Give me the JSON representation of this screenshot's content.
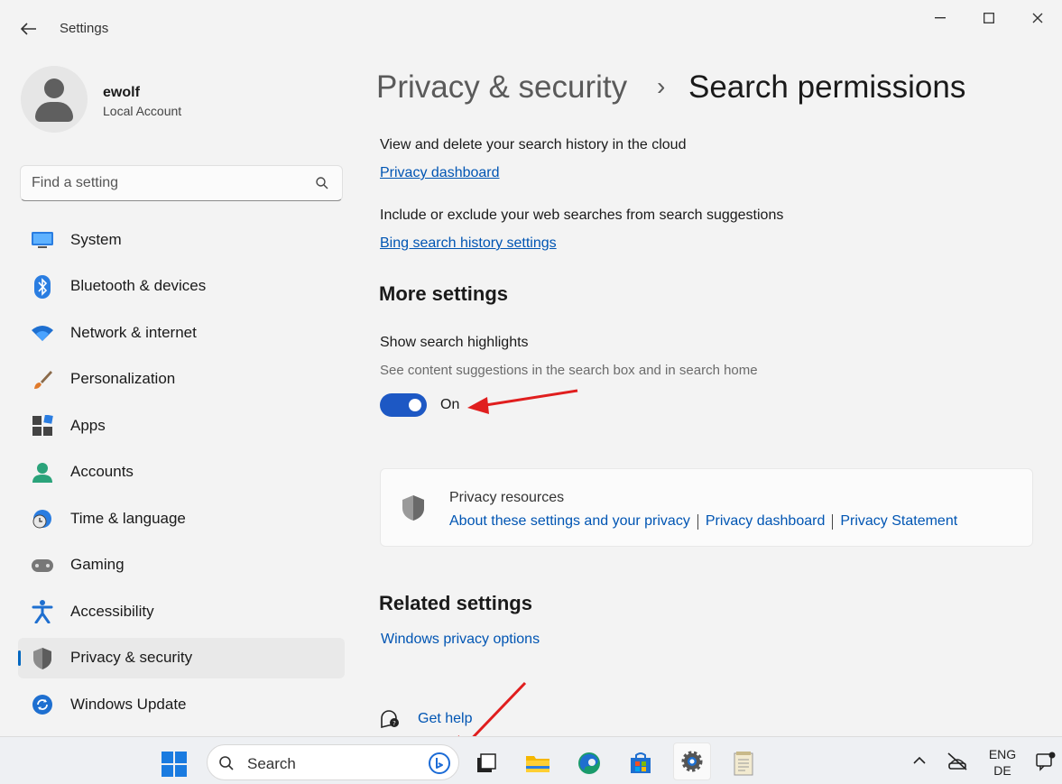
{
  "window": {
    "title": "Settings",
    "controls": {
      "minimize": "—",
      "maximize": "☐",
      "close": "✕"
    }
  },
  "profile": {
    "name": "ewolf",
    "account_type": "Local Account"
  },
  "search": {
    "placeholder": "Find a setting"
  },
  "sidebar": {
    "items": [
      {
        "label": "System",
        "icon": "system-icon"
      },
      {
        "label": "Bluetooth & devices",
        "icon": "bluetooth-icon"
      },
      {
        "label": "Network & internet",
        "icon": "wifi-icon"
      },
      {
        "label": "Personalization",
        "icon": "brush-icon"
      },
      {
        "label": "Apps",
        "icon": "apps-icon"
      },
      {
        "label": "Accounts",
        "icon": "accounts-icon"
      },
      {
        "label": "Time & language",
        "icon": "clock-globe-icon"
      },
      {
        "label": "Gaming",
        "icon": "gamepad-icon"
      },
      {
        "label": "Accessibility",
        "icon": "accessibility-icon"
      },
      {
        "label": "Privacy & security",
        "icon": "shield-icon",
        "selected": true
      },
      {
        "label": "Windows Update",
        "icon": "update-icon"
      }
    ]
  },
  "breadcrumb": {
    "parent": "Privacy & security",
    "separator": "›",
    "current": "Search permissions"
  },
  "main": {
    "history_cloud_text": "View and delete your search history in the cloud",
    "privacy_dashboard_link": "Privacy dashboard",
    "web_searches_text": "Include or exclude your web searches from search suggestions",
    "bing_history_link": "Bing search history settings",
    "more_settings_heading": "More settings",
    "highlights_title": "Show search highlights",
    "highlights_desc": "See content suggestions in the search box and in search home",
    "highlights_toggle_state": "On",
    "highlights_enabled": true,
    "privacy_resources": {
      "title": "Privacy resources",
      "links": [
        "About these settings and your privacy",
        "Privacy dashboard",
        "Privacy Statement"
      ]
    },
    "related_heading": "Related settings",
    "windows_privacy_link": "Windows privacy options",
    "get_help_link": "Get help"
  },
  "taskbar": {
    "search_label": "Search",
    "language": {
      "line1": "ENG",
      "line2": "DE"
    },
    "apps": [
      "task-view-icon",
      "file-explorer-icon",
      "edge-icon",
      "store-icon",
      "settings-icon",
      "notepad-icon"
    ]
  },
  "colors": {
    "accent": "#1d58c4",
    "link": "#0055b3",
    "annotation_arrow": "#e01e1e"
  }
}
